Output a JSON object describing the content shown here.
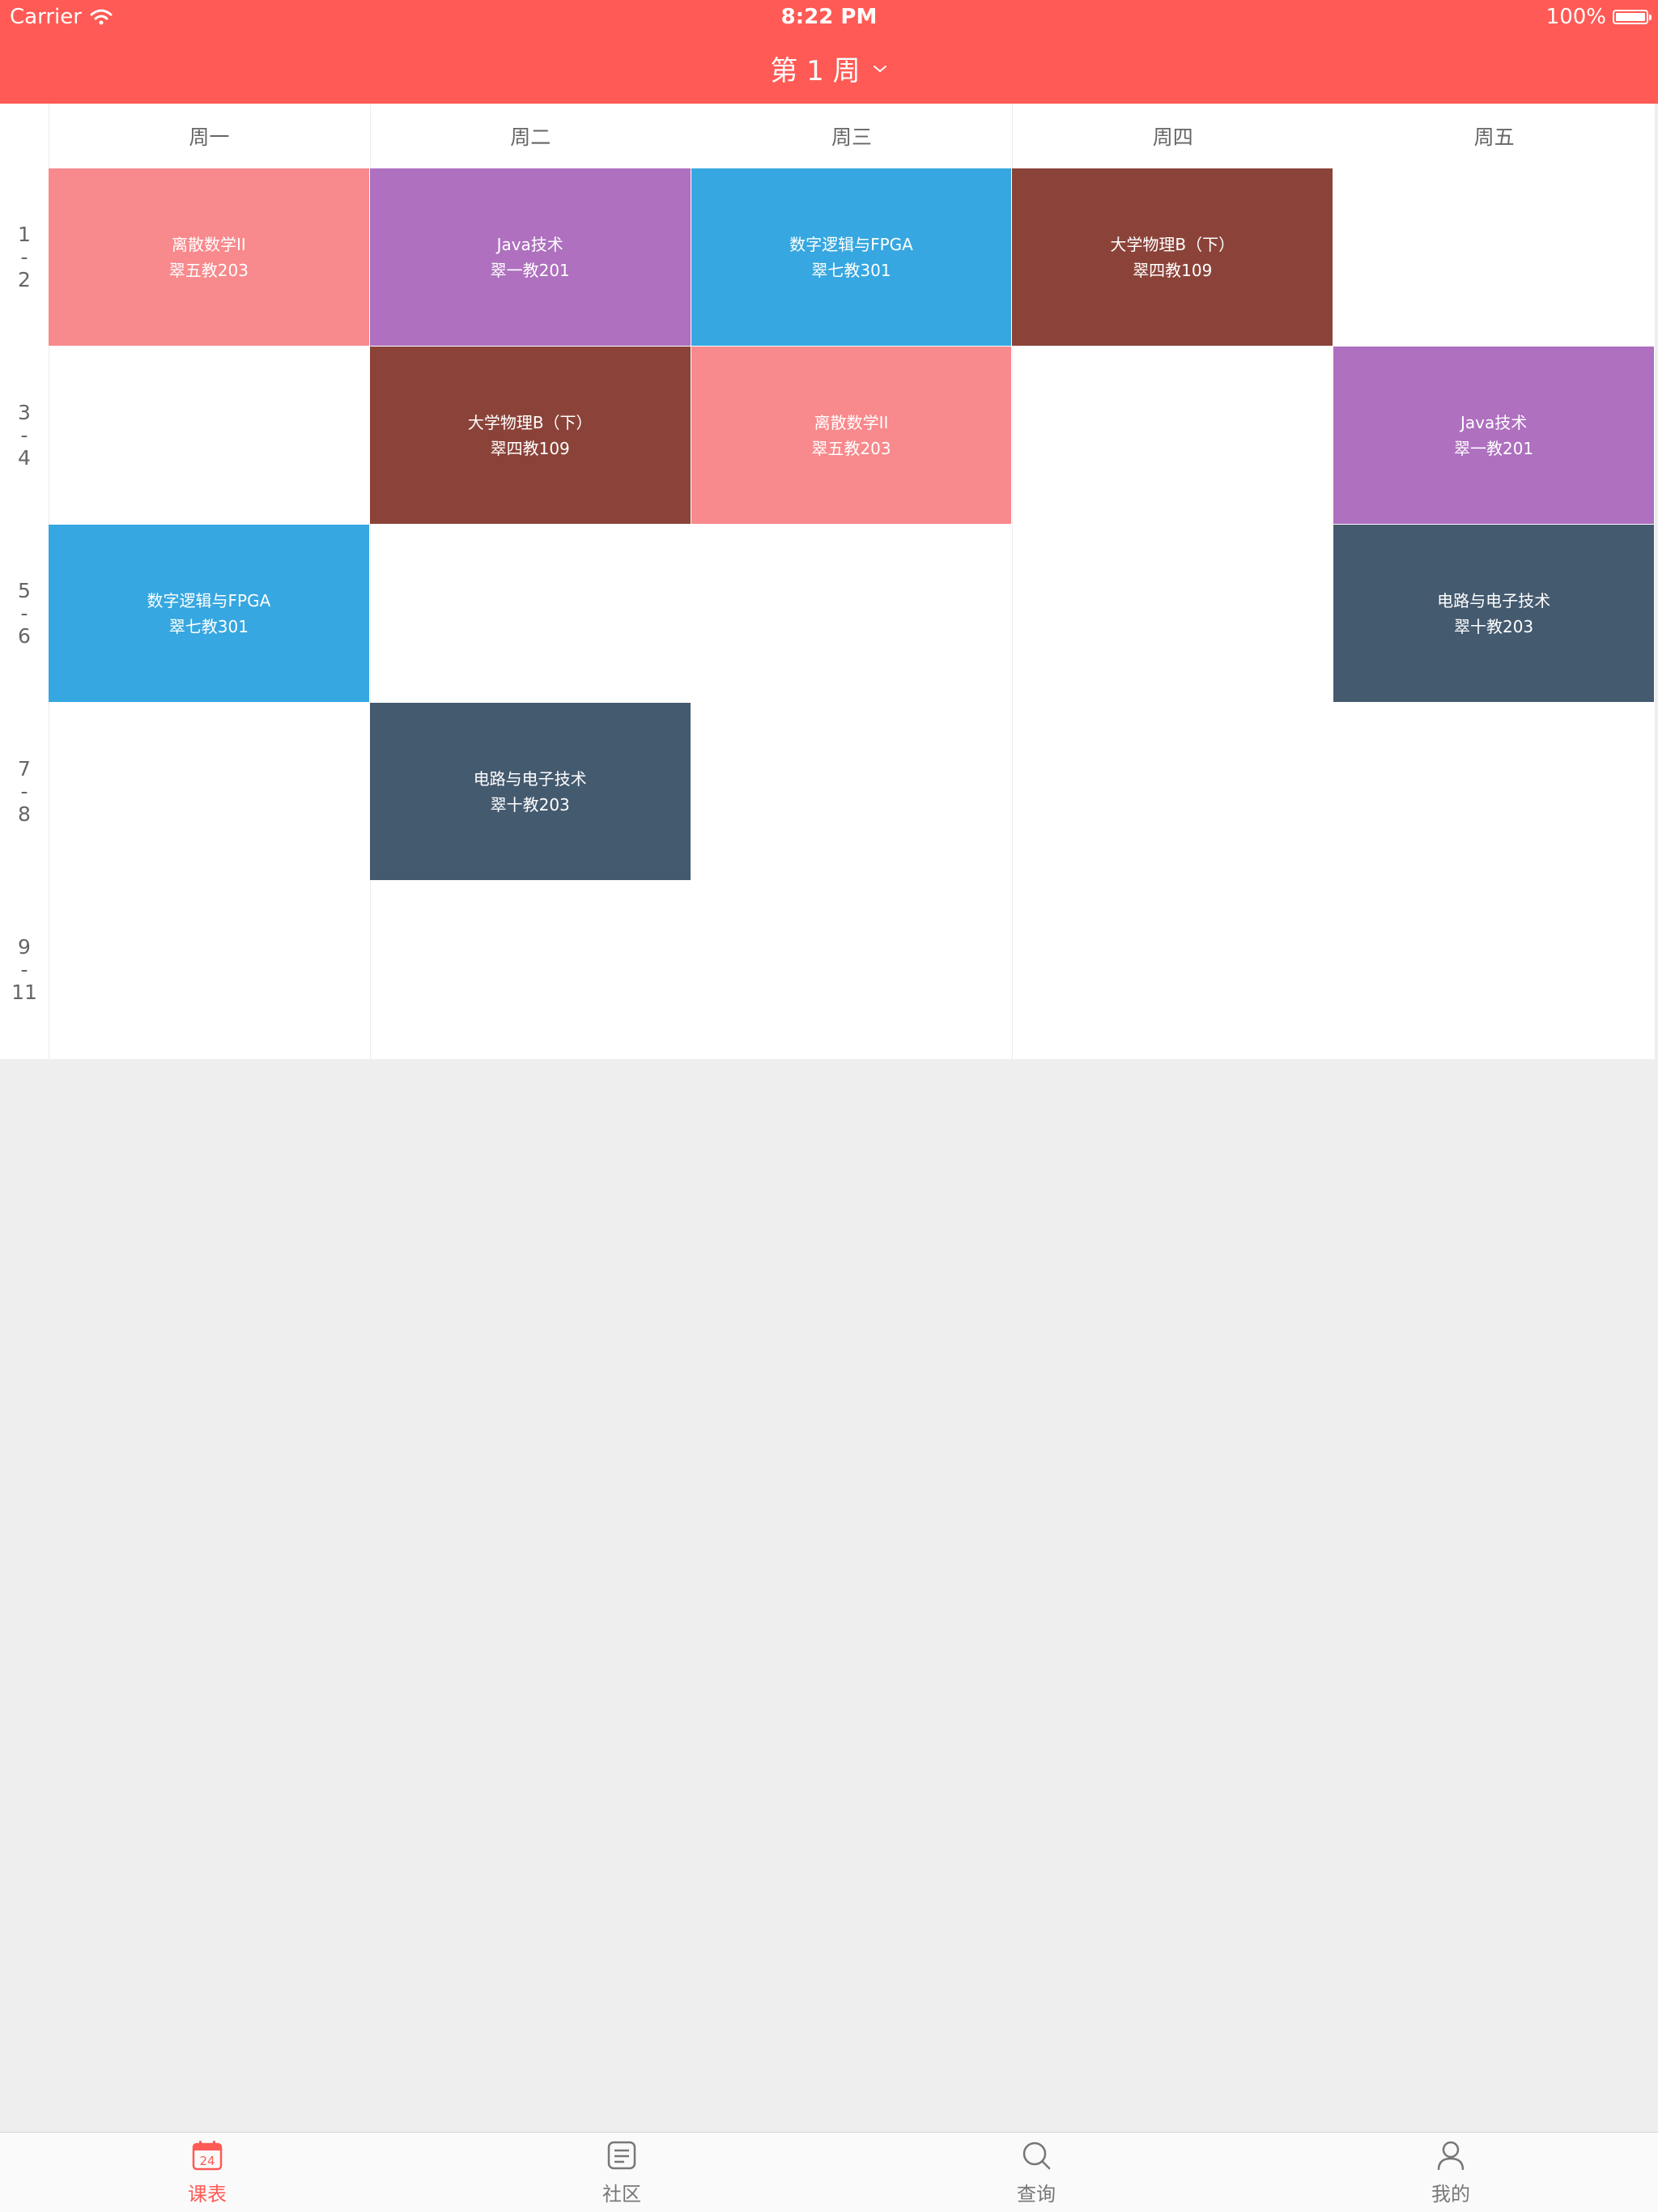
{
  "status_bar": {
    "carrier": "Carrier",
    "time": "8:22 PM",
    "battery": "100%",
    "battery_level": 1.0
  },
  "header": {
    "week_title": "第 1 周"
  },
  "days": [
    "周一",
    "周二",
    "周三",
    "周四",
    "周五"
  ],
  "periods": [
    [
      "1",
      "-",
      "2"
    ],
    [
      "3",
      "-",
      "4"
    ],
    [
      "5",
      "-",
      "6"
    ],
    [
      "7",
      "-",
      "8"
    ],
    [
      "9",
      "-",
      "11"
    ]
  ],
  "courses": [
    {
      "day": 0,
      "start": 0,
      "span": 1,
      "name": "离散数学II",
      "room": "翠五教203",
      "color": "#f8898c"
    },
    {
      "day": 1,
      "start": 0,
      "span": 1,
      "name": "Java技术",
      "room": "翠一教201",
      "color": "#ae70bf"
    },
    {
      "day": 2,
      "start": 0,
      "span": 1,
      "name": "数字逻辑与FPGA",
      "room": "翠七教301",
      "color": "#36a7e0"
    },
    {
      "day": 3,
      "start": 0,
      "span": 1,
      "name": "大学物理B（下）",
      "room": "翠四教109",
      "color": "#8b4339"
    },
    {
      "day": 1,
      "start": 1,
      "span": 1,
      "name": "大学物理B（下）",
      "room": "翠四教109",
      "color": "#8b4339"
    },
    {
      "day": 2,
      "start": 1,
      "span": 1,
      "name": "离散数学II",
      "room": "翠五教203",
      "color": "#f8898c"
    },
    {
      "day": 4,
      "start": 1,
      "span": 1,
      "name": "Java技术",
      "room": "翠一教201",
      "color": "#ae70bf"
    },
    {
      "day": 0,
      "start": 2,
      "span": 1,
      "name": "数字逻辑与FPGA",
      "room": "翠七教301",
      "color": "#36a7e0"
    },
    {
      "day": 4,
      "start": 2,
      "span": 1,
      "name": "电路与电子技术",
      "room": "翠十教203",
      "color": "#445a6f"
    },
    {
      "day": 1,
      "start": 3,
      "span": 1,
      "name": "电路与电子技术",
      "room": "翠十教203",
      "color": "#445a6f"
    }
  ],
  "tabs": [
    {
      "label": "课表",
      "icon": "calendar-icon",
      "calendar_number": "24",
      "active": true
    },
    {
      "label": "社区",
      "icon": "community-icon",
      "active": false
    },
    {
      "label": "查询",
      "icon": "search-icon",
      "active": false
    },
    {
      "label": "我的",
      "icon": "profile-icon",
      "active": false
    }
  ],
  "colors": {
    "accent": "#ff5a55",
    "tab_inactive": "#777777",
    "background": "#eeeeee"
  }
}
